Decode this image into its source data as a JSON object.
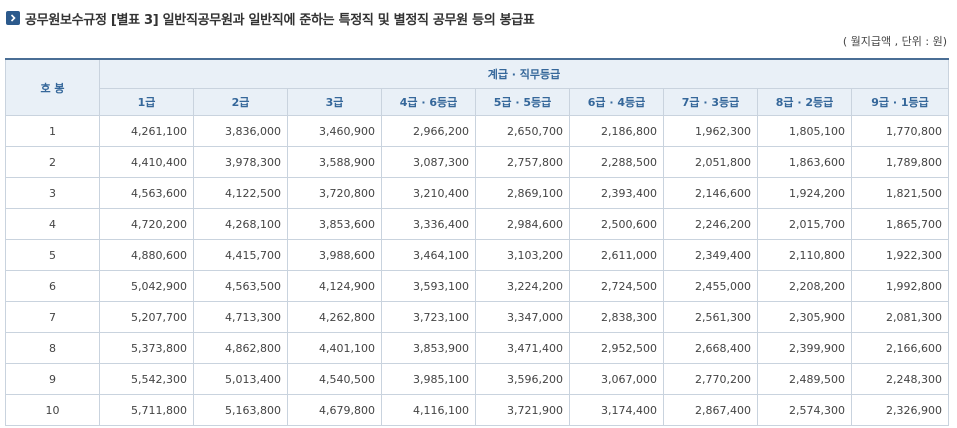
{
  "page": {
    "title": "공무원보수규정 [별표 3] 일반직공무원과 일반직에 준하는 특정직 및 별정직 공무원 등의 봉급표",
    "unit_note": "( 월지급액 , 단위 : 원)"
  },
  "table": {
    "step_header": "호 봉",
    "group_header": "계급 · 직무등급",
    "grade_headers": [
      "1급",
      "2급",
      "3급",
      "4급 · 6등급",
      "5급 · 5등급",
      "6급 · 4등급",
      "7급 · 3등급",
      "8급 · 2등급",
      "9급 · 1등급"
    ],
    "rows": [
      {
        "step": "1",
        "values": [
          "4,261,100",
          "3,836,000",
          "3,460,900",
          "2,966,200",
          "2,650,700",
          "2,186,800",
          "1,962,300",
          "1,805,100",
          "1,770,800"
        ]
      },
      {
        "step": "2",
        "values": [
          "4,410,400",
          "3,978,300",
          "3,588,900",
          "3,087,300",
          "2,757,800",
          "2,288,500",
          "2,051,800",
          "1,863,600",
          "1,789,800"
        ]
      },
      {
        "step": "3",
        "values": [
          "4,563,600",
          "4,122,500",
          "3,720,800",
          "3,210,400",
          "2,869,100",
          "2,393,400",
          "2,146,600",
          "1,924,200",
          "1,821,500"
        ]
      },
      {
        "step": "4",
        "values": [
          "4,720,200",
          "4,268,100",
          "3,853,600",
          "3,336,400",
          "2,984,600",
          "2,500,600",
          "2,246,200",
          "2,015,700",
          "1,865,700"
        ]
      },
      {
        "step": "5",
        "values": [
          "4,880,600",
          "4,415,700",
          "3,988,600",
          "3,464,100",
          "3,103,200",
          "2,611,000",
          "2,349,400",
          "2,110,800",
          "1,922,300"
        ]
      },
      {
        "step": "6",
        "values": [
          "5,042,900",
          "4,563,500",
          "4,124,900",
          "3,593,100",
          "3,224,200",
          "2,724,500",
          "2,455,000",
          "2,208,200",
          "1,992,800"
        ]
      },
      {
        "step": "7",
        "values": [
          "5,207,700",
          "4,713,300",
          "4,262,800",
          "3,723,100",
          "3,347,000",
          "2,838,300",
          "2,561,300",
          "2,305,900",
          "2,081,300"
        ]
      },
      {
        "step": "8",
        "values": [
          "5,373,800",
          "4,862,800",
          "4,401,100",
          "3,853,900",
          "3,471,400",
          "2,952,500",
          "2,668,400",
          "2,399,900",
          "2,166,600"
        ]
      },
      {
        "step": "9",
        "values": [
          "5,542,300",
          "5,013,400",
          "4,540,500",
          "3,985,100",
          "3,596,200",
          "3,067,000",
          "2,770,200",
          "2,489,500",
          "2,248,300"
        ]
      },
      {
        "step": "10",
        "values": [
          "5,711,800",
          "5,163,800",
          "4,679,800",
          "4,116,100",
          "3,721,900",
          "3,174,400",
          "2,867,400",
          "2,574,300",
          "2,326,900"
        ]
      }
    ]
  },
  "colors": {
    "header_bg": "#e9f0f7",
    "header_text": "#35679a",
    "border": "#c9d3de",
    "accent": "#2c5a8c"
  }
}
